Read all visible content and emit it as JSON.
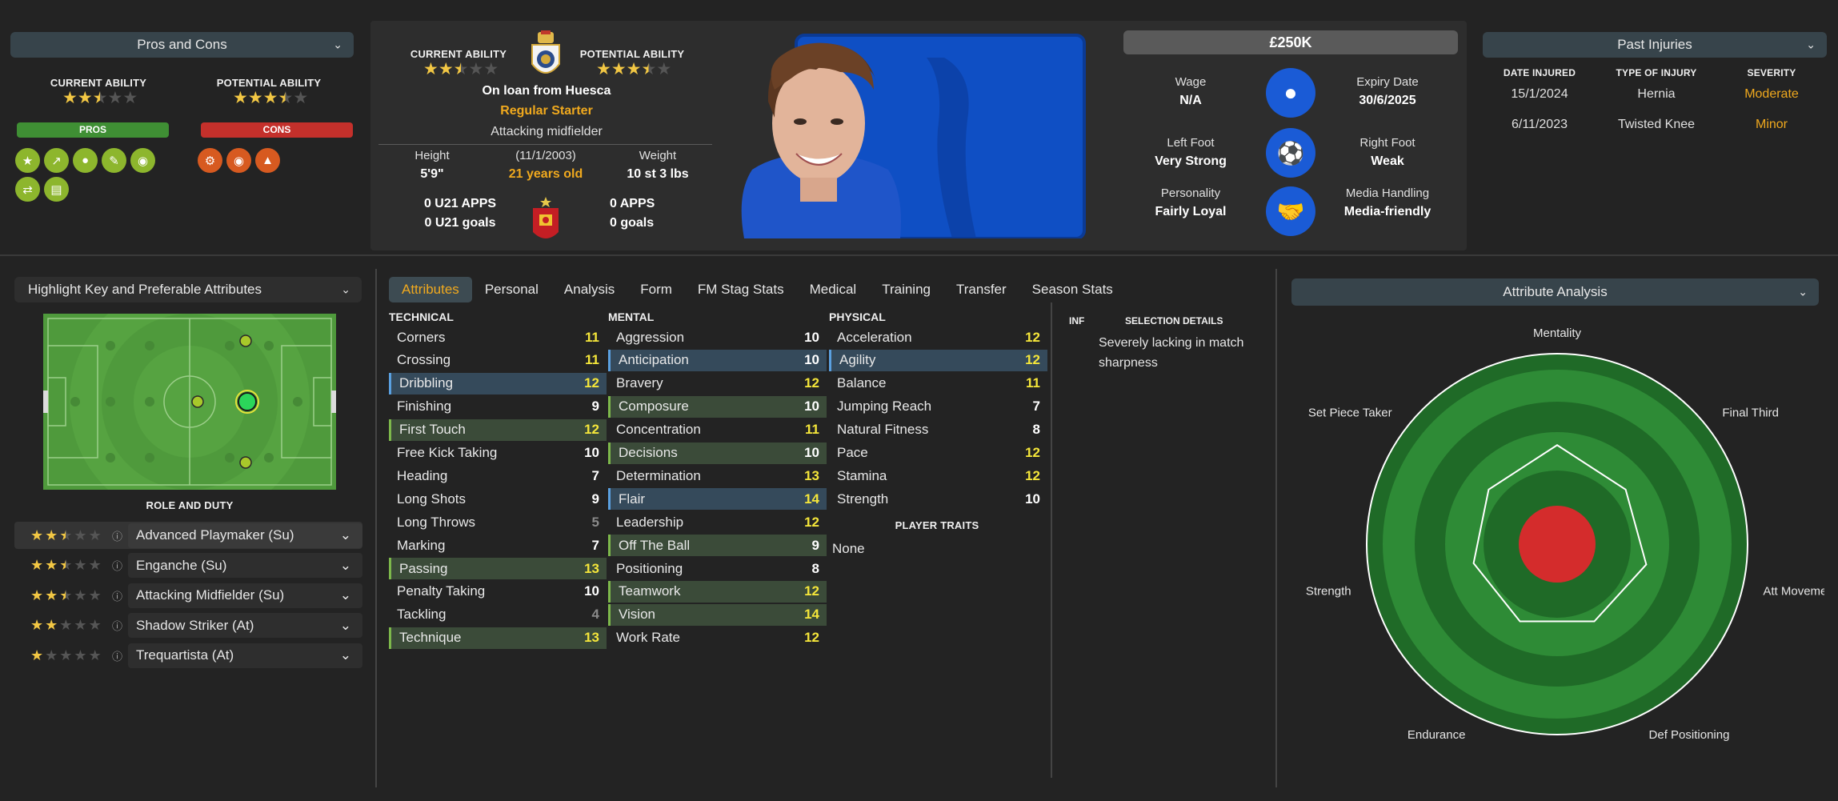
{
  "pros_cons": {
    "dropdown_label": "Pros and Cons",
    "current_ability_label": "CURRENT ABILITY",
    "potential_ability_label": "POTENTIAL ABILITY",
    "current_ability_stars": 2.5,
    "potential_ability_stars": 3.5,
    "pros_label": "PROS",
    "cons_label": "CONS",
    "pros_icons": [
      "star-icon",
      "trend-up-icon",
      "head-icon",
      "pencil-icon",
      "eye-icon",
      "handshake-icon",
      "clipboard-icon"
    ],
    "cons_icons": [
      "gears-icon",
      "whistle-icon",
      "flask-icon"
    ]
  },
  "header": {
    "current_ability_label": "CURRENT ABILITY",
    "potential_ability_label": "POTENTIAL ABILITY",
    "current_stars": 2.5,
    "potential_stars": 3.5,
    "loan_text": "On loan from Huesca",
    "squad_status": "Regular Starter",
    "position": "Attacking midfielder",
    "height_label": "Height",
    "height_value": "5'9\"",
    "dob_label": "(11/1/2003)",
    "age_value": "21 years old",
    "weight_label": "Weight",
    "weight_value": "10 st 3 lbs",
    "u21_apps": "0 U21 APPS",
    "u21_goals": "0 U21 goals",
    "apps": "0 APPS",
    "goals": "0 goals"
  },
  "contract": {
    "value": "£250K",
    "wage_label": "Wage",
    "wage_value": "N/A",
    "expiry_label": "Expiry Date",
    "expiry_value": "30/6/2025",
    "left_foot_label": "Left Foot",
    "left_foot_value": "Very Strong",
    "right_foot_label": "Right Foot",
    "right_foot_value": "Weak",
    "personality_label": "Personality",
    "personality_value": "Fairly Loyal",
    "media_label": "Media Handling",
    "media_value": "Media-friendly"
  },
  "injuries": {
    "dropdown_label": "Past Injuries",
    "headers": [
      "DATE INJURED",
      "TYPE OF INJURY",
      "SEVERITY"
    ],
    "rows": [
      {
        "date": "15/1/2024",
        "type": "Hernia",
        "severity": "Moderate"
      },
      {
        "date": "6/11/2023",
        "type": "Twisted Knee",
        "severity": "Minor"
      }
    ],
    "colors": {
      "moderate": "#f0a91e",
      "minor": "#f0a91e"
    }
  },
  "left": {
    "highlight_dropdown": "Highlight Key and Preferable Attributes",
    "role_duty_label": "ROLE AND DUTY",
    "roles": [
      {
        "stars": 2.5,
        "name": "Advanced Playmaker (Su)"
      },
      {
        "stars": 2.5,
        "name": "Enganche (Su)"
      },
      {
        "stars": 2.5,
        "name": "Attacking Midfielder (Su)"
      },
      {
        "stars": 2,
        "name": "Shadow Striker (At)"
      },
      {
        "stars": 1,
        "name": "Trequartista (At)"
      }
    ]
  },
  "tabs": [
    "Attributes",
    "Personal",
    "Analysis",
    "Form",
    "FM Stag Stats",
    "Medical",
    "Training",
    "Transfer",
    "Season Stats"
  ],
  "attributes": {
    "technical_label": "TECHNICAL",
    "mental_label": "MENTAL",
    "physical_label": "PHYSICAL",
    "technical": [
      {
        "name": "Corners",
        "value": "11",
        "hl": ""
      },
      {
        "name": "Crossing",
        "value": "11",
        "hl": ""
      },
      {
        "name": "Dribbling",
        "value": "12",
        "hl": "blue"
      },
      {
        "name": "Finishing",
        "value": "9",
        "hl": ""
      },
      {
        "name": "First Touch",
        "value": "12",
        "hl": "green"
      },
      {
        "name": "Free Kick Taking",
        "value": "10",
        "hl": ""
      },
      {
        "name": "Heading",
        "value": "7",
        "hl": ""
      },
      {
        "name": "Long Shots",
        "value": "9",
        "hl": ""
      },
      {
        "name": "Long Throws",
        "value": "5",
        "hl": ""
      },
      {
        "name": "Marking",
        "value": "7",
        "hl": ""
      },
      {
        "name": "Passing",
        "value": "13",
        "hl": "green"
      },
      {
        "name": "Penalty Taking",
        "value": "10",
        "hl": ""
      },
      {
        "name": "Tackling",
        "value": "4",
        "hl": ""
      },
      {
        "name": "Technique",
        "value": "13",
        "hl": "green"
      }
    ],
    "mental": [
      {
        "name": "Aggression",
        "value": "10",
        "hl": ""
      },
      {
        "name": "Anticipation",
        "value": "10",
        "hl": "blue"
      },
      {
        "name": "Bravery",
        "value": "12",
        "hl": ""
      },
      {
        "name": "Composure",
        "value": "10",
        "hl": "green"
      },
      {
        "name": "Concentration",
        "value": "11",
        "hl": ""
      },
      {
        "name": "Decisions",
        "value": "10",
        "hl": "green"
      },
      {
        "name": "Determination",
        "value": "13",
        "hl": ""
      },
      {
        "name": "Flair",
        "value": "14",
        "hl": "blue"
      },
      {
        "name": "Leadership",
        "value": "12",
        "hl": ""
      },
      {
        "name": "Off The Ball",
        "value": "9",
        "hl": "green"
      },
      {
        "name": "Positioning",
        "value": "8",
        "hl": ""
      },
      {
        "name": "Teamwork",
        "value": "12",
        "hl": "green"
      },
      {
        "name": "Vision",
        "value": "14",
        "hl": "green"
      },
      {
        "name": "Work Rate",
        "value": "12",
        "hl": ""
      }
    ],
    "physical": [
      {
        "name": "Acceleration",
        "value": "12",
        "hl": ""
      },
      {
        "name": "Agility",
        "value": "12",
        "hl": "blue"
      },
      {
        "name": "Balance",
        "value": "11",
        "hl": ""
      },
      {
        "name": "Jumping Reach",
        "value": "7",
        "hl": ""
      },
      {
        "name": "Natural Fitness",
        "value": "8",
        "hl": ""
      },
      {
        "name": "Pace",
        "value": "12",
        "hl": ""
      },
      {
        "name": "Stamina",
        "value": "12",
        "hl": ""
      },
      {
        "name": "Strength",
        "value": "10",
        "hl": ""
      }
    ],
    "player_traits_label": "PLAYER TRAITS",
    "player_traits_value": "None"
  },
  "selection": {
    "inf_label": "INF",
    "details_label": "SELECTION DETAILS",
    "details_text": "Severely lacking in match sharpness"
  },
  "analysis": {
    "dropdown_label": "Attribute Analysis",
    "axes": [
      "Mentality",
      "Final Third",
      "Att Movement",
      "Def Positioning",
      "Endurance",
      "Strength",
      "Set Piece Taker"
    ],
    "values": [
      0.52,
      0.46,
      0.48,
      0.45,
      0.45,
      0.45,
      0.46
    ]
  },
  "colors": {
    "accent_yellow": "#f0a91e",
    "pros_green": "#3f8f34",
    "cons_red": "#c4302b",
    "pitch_green": "#4f9a3c",
    "radar_dark": "#1f6a27",
    "radar_light": "#2e8b36",
    "radar_core": "#d42c2c"
  }
}
